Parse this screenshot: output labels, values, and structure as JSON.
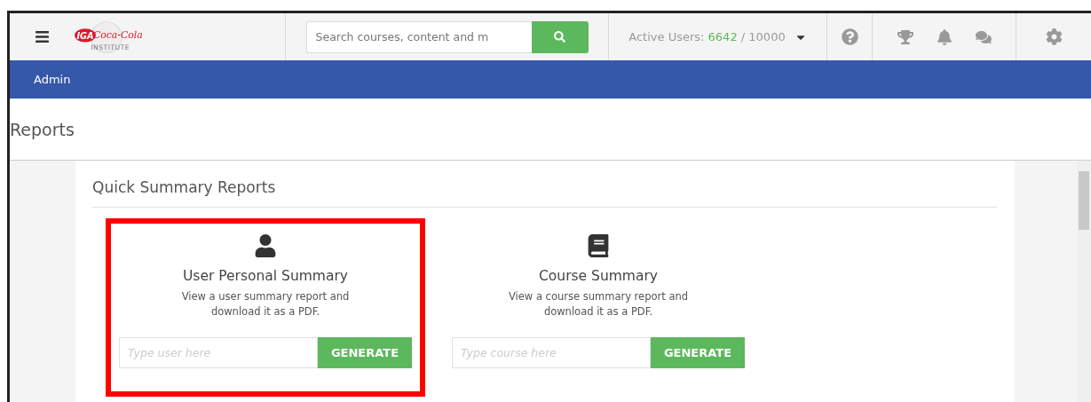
{
  "header": {
    "logo": {
      "mark": "IGA",
      "script": "Coca-Cola",
      "tagline": "INSTITUTE"
    },
    "search": {
      "placeholder": "Search courses, content and m"
    },
    "active_users": {
      "label": "Active Users:",
      "count": "6642",
      "limit": "/ 10000"
    }
  },
  "nav": {
    "items": [
      {
        "label": "Admin"
      }
    ]
  },
  "page": {
    "title": "Reports"
  },
  "section": {
    "title": "Quick Summary Reports",
    "cards": [
      {
        "kind": "user",
        "title": "User Personal Summary",
        "description": "View a user summary report and download it as a PDF.",
        "placeholder": "Type user here",
        "button": "GENERATE",
        "highlighted": true
      },
      {
        "kind": "course",
        "title": "Course Summary",
        "description": "View a course summary report and download it as a PDF.",
        "placeholder": "Type course here",
        "button": "GENERATE",
        "highlighted": false
      }
    ]
  }
}
